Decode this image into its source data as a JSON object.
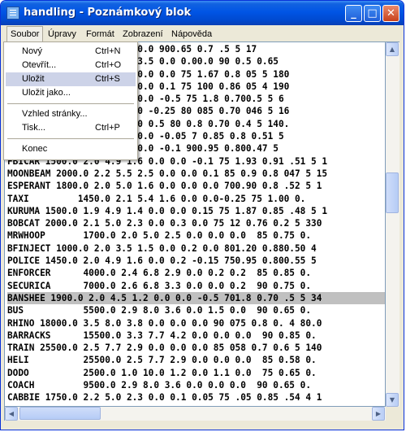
{
  "window": {
    "title": "handling - Poznámkový blok",
    "buttons": {
      "minimize": "_",
      "maximize": "□",
      "close": "✕"
    }
  },
  "menubar": {
    "items": [
      "Soubor",
      "Úpravy",
      "Formát",
      "Zobrazení",
      "Nápověda"
    ]
  },
  "file_menu": {
    "items": [
      {
        "label": "Nový",
        "shortcut": "Ctrl+N"
      },
      {
        "label": "Otevřít...",
        "shortcut": "Ctrl+O"
      },
      {
        "label": "Uložit",
        "shortcut": "Ctrl+S"
      },
      {
        "label": "Uložit jako...",
        "shortcut": ""
      },
      {
        "label": "Vzhled stránky...",
        "shortcut": ""
      },
      {
        "label": "Tisk...",
        "shortcut": "Ctrl+P"
      },
      {
        "label": "Konec",
        "shortcut": ""
      }
    ],
    "highlighted": "Uložit"
  },
  "editor": {
    "lines": [
      "             .7 3.8 0.0 0.0 900.65 0.7 .5 5 17",
      "             .0 2.6 7.5 3.5 0.0 0.00.0 90 0.5 0.65",
      "             .3 1.3 0.0 0.0 0.0 75 1.67 0.8 05 5 180",
      "             .5 1.4 0.0 0.0 0.1 75 100 0.86 05 4 190",
      "             .5 1.2 0.0 0.0 -0.5 75 1.8 0.700.5 5 6",
      "             .2.6 0.0 0.0 -0.25 80 085 0.70 046 5 16",
      "             .3.3 0.0 0.0 0.5 80 0.8 0.70 0.4 5 140.",
      "             .9 1.5 0.0 0.0 -0.05 7 0.85 0.8 0.51 5",
      "             .5 2.0 0.0 0.0 -0.1 900.95 0.800.47 5",
      "FBICAR 1500.0 2.0 4.9 1.6 0.0 0.0 -0.1 75 1.93 0.91 .51 5 1",
      "MOONBEAM 2000.0 2.2 5.5 2.5 0.0 0.0 0.1 85 0.9 0.8 047 5 15",
      "ESPERANT 1800.0 2.0 5.0 1.6 0.0 0.0 0.0 700.90 0.8 .52 5 1",
      "TAXI         1450.0 2.1 5.4 1.6 0.0 0.0-0.25 75 1.00 0.",
      "KURUMA 1500.0 1.9 4.9 1.4 0.0 0.0 0.15 75 1.87 0.85 .48 5 1",
      "BOBCAT 2000.0 2.1 5.0 2.3 0.0 0.3 0.0 75 12 0.76 0.2 5 330",
      "MRWHOOP       1700.0 2.0 5.0 2.5 0.0 0.0 0.0  85 0.75 0.",
      "BFINJECT 1000.0 2.0 3.5 1.5 0.0 0.2 0.0 801.20 0.880.50 4",
      "POLICE 1450.0 2.0 4.9 1.6 0.0 0.2 -0.15 750.95 0.800.55 5",
      "ENFORCER      4000.0 2.4 6.8 2.9 0.0 0.2 0.2  85 0.85 0.",
      "SECURICA      7000.0 2.6 6.8 3.3 0.0 0.0 0.2  90 0.75 0.",
      "BANSHEE 1900.0 2.0 4.5 1.2 0.0 0.0 -0.5 701.8 0.70 .5 5 34",
      "BUS           5500.0 2.9 8.0 3.6 0.0 1.5 0.0  90 0.65 0.",
      "RHINO 18000.0 3.5 8.0 3.8 0.0 0.0 0.0 90 075 0.8 0. 4 80.0",
      "BARRACKS      15500.0 3.3 7.7 4.2 0.0 0.0 0.0  90 0.85 0.",
      "TRAIN 25500.0 2.5 7.7 2.9 0.0 0.0 0.0 85 058 0.7 0.6 5 140",
      "HELI          25500.0 2.5 7.7 2.9 0.0 0.0 0.0  85 0.58 0.",
      "DODO          2500.0 1.0 10.0 1.2 0.0 1.1 0.0  75 0.65 0.",
      "COACH         9500.0 2.9 8.0 3.6 0.0 0.0 0.0  90 0.65 0.",
      "CABBIE 1750.0 2.2 5.0 2.3 0.0 0.1 0.05 75 .05 0.85 .54 4 1"
    ],
    "selected_line": 20
  }
}
